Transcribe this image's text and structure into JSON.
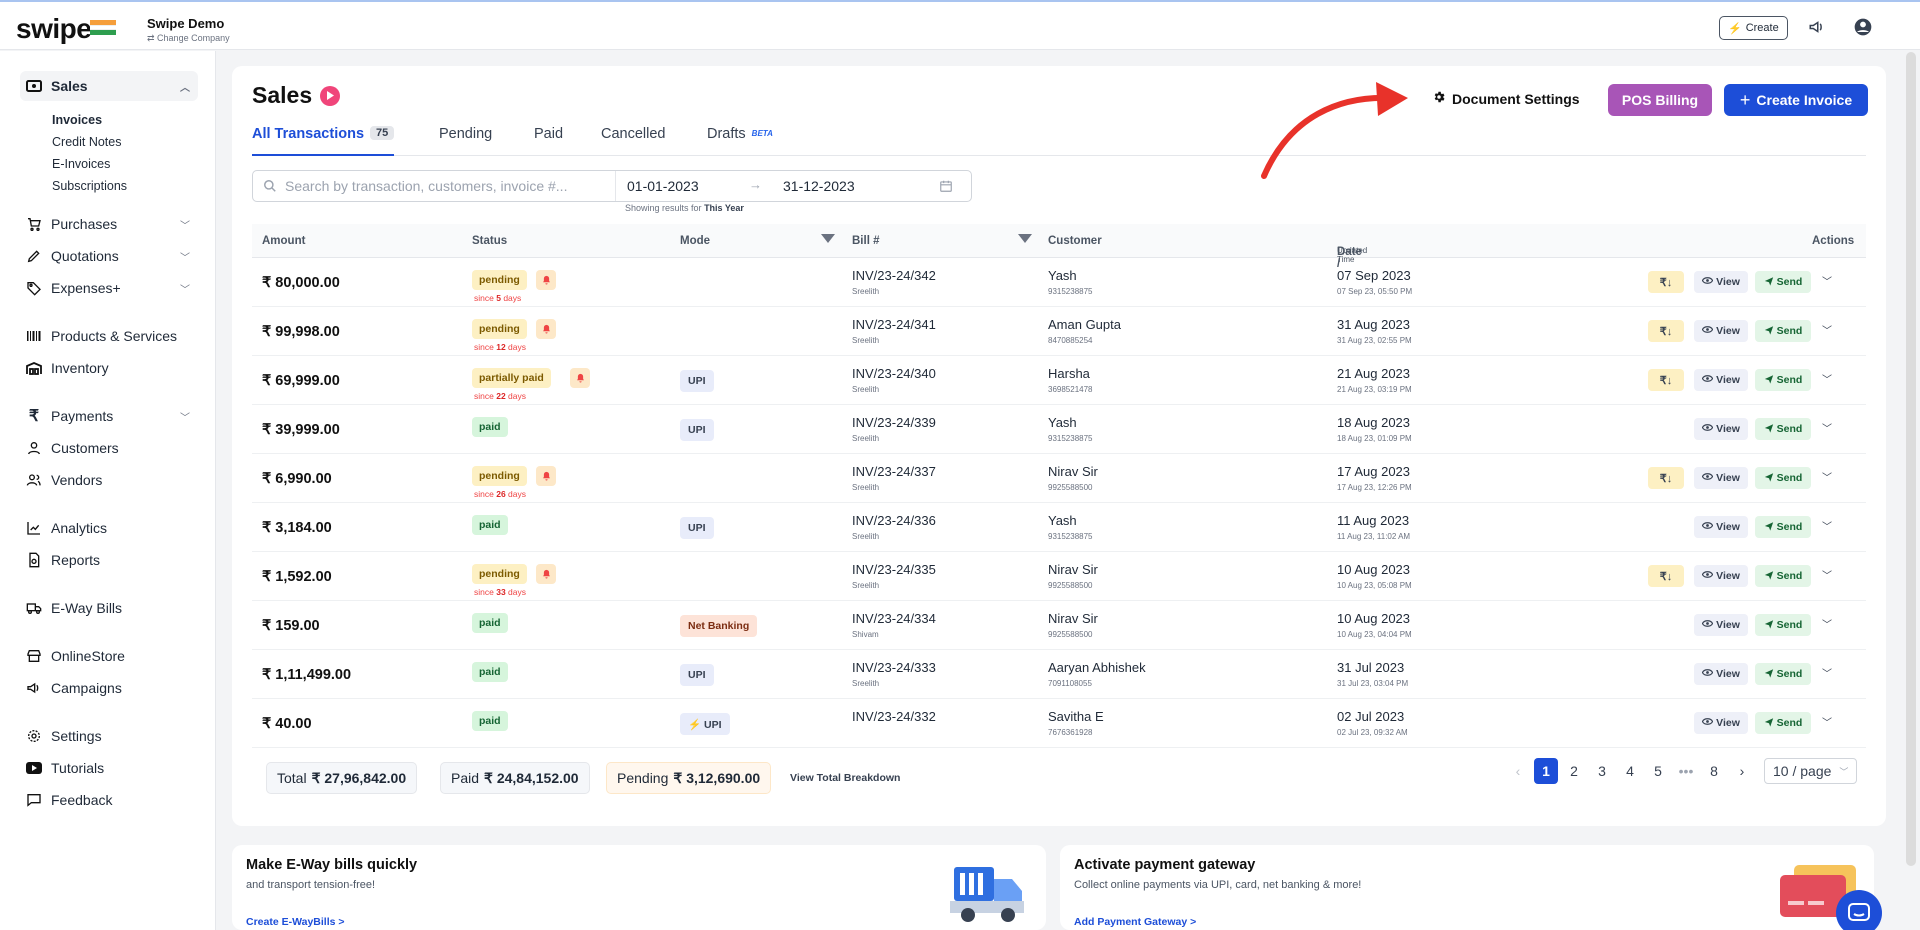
{
  "brand": {
    "logo": "swipe",
    "company": "Swipe Demo",
    "change_company": "Change Company"
  },
  "top": {
    "create": "Create"
  },
  "sidebar": {
    "sales": "Sales",
    "sales_sub": [
      "Invoices",
      "Credit Notes",
      "E-Invoices",
      "Subscriptions"
    ],
    "items": [
      "Purchases",
      "Quotations",
      "Expenses+",
      "Products & Services",
      "Inventory",
      "Payments",
      "Customers",
      "Vendors",
      "Analytics",
      "Reports",
      "E-Way Bills",
      "OnlineStore",
      "Campaigns",
      "Settings",
      "Tutorials",
      "Feedback"
    ]
  },
  "main": {
    "title": "Sales",
    "tabs": [
      {
        "label": "All Transactions",
        "count": "75"
      },
      {
        "label": "Pending"
      },
      {
        "label": "Paid"
      },
      {
        "label": "Cancelled"
      },
      {
        "label": "Drafts",
        "tag": "BETA"
      }
    ],
    "document_settings": "Document Settings",
    "pos_billing": "POS Billing",
    "create_invoice": "Create Invoice",
    "search_placeholder": "Search by transaction, customers, invoice #...",
    "date_from": "01-01-2023",
    "date_to": "31-12-2023",
    "showing_prefix": "Showing results for",
    "showing_range": "This Year",
    "columns": {
      "amount": "Amount",
      "status": "Status",
      "mode": "Mode",
      "bill": "Bill #",
      "customer": "Customer",
      "date": "Date /",
      "date_sub": "Updated Time",
      "actions": "Actions"
    }
  },
  "rows": [
    {
      "amount": "₹ 80,000.00",
      "status": "pending",
      "since_pre": "since ",
      "since_days": "5",
      "since_post": " days",
      "mode": "",
      "bill": "INV/23-24/342",
      "bill_sub": "Sreelith",
      "customer": "Yash",
      "phone": "9315238875",
      "date": "07 Sep 2023",
      "date_sub": "07 Sep 23, 05:50 PM",
      "rupee": true
    },
    {
      "amount": "₹ 99,998.00",
      "status": "pending",
      "since_pre": "since ",
      "since_days": "12",
      "since_post": " days",
      "mode": "",
      "bill": "INV/23-24/341",
      "bill_sub": "Sreelith",
      "customer": "Aman Gupta",
      "phone": "8470885254",
      "date": "31 Aug 2023",
      "date_sub": "31 Aug 23, 02:55 PM",
      "rupee": true
    },
    {
      "amount": "₹ 69,999.00",
      "status": "partially paid",
      "since_pre": "since ",
      "since_days": "22",
      "since_post": " days",
      "mode": "UPI",
      "bill": "INV/23-24/340",
      "bill_sub": "Sreelith",
      "customer": "Harsha",
      "phone": "3698521478",
      "date": "21 Aug 2023",
      "date_sub": "21 Aug 23, 03:19 PM",
      "rupee": true
    },
    {
      "amount": "₹ 39,999.00",
      "status": "paid",
      "since_pre": "",
      "since_days": "",
      "since_post": "",
      "mode": "UPI",
      "bill": "INV/23-24/339",
      "bill_sub": "Sreelith",
      "customer": "Yash",
      "phone": "9315238875",
      "date": "18 Aug 2023",
      "date_sub": "18 Aug 23, 01:09 PM",
      "rupee": false
    },
    {
      "amount": "₹ 6,990.00",
      "status": "pending",
      "since_pre": "since ",
      "since_days": "26",
      "since_post": " days",
      "mode": "",
      "bill": "INV/23-24/337",
      "bill_sub": "Sreelith",
      "customer": "Nirav Sir",
      "phone": "9925588500",
      "date": "17 Aug 2023",
      "date_sub": "17 Aug 23, 12:26 PM",
      "rupee": true
    },
    {
      "amount": "₹ 3,184.00",
      "status": "paid",
      "since_pre": "",
      "since_days": "",
      "since_post": "",
      "mode": "UPI",
      "bill": "INV/23-24/336",
      "bill_sub": "Sreelith",
      "customer": "Yash",
      "phone": "9315238875",
      "date": "11 Aug 2023",
      "date_sub": "11 Aug 23, 11:02 AM",
      "rupee": false
    },
    {
      "amount": "₹ 1,592.00",
      "status": "pending",
      "since_pre": "since ",
      "since_days": "33",
      "since_post": " days",
      "mode": "",
      "bill": "INV/23-24/335",
      "bill_sub": "Sreelith",
      "customer": "Nirav Sir",
      "phone": "9925588500",
      "date": "10 Aug 2023",
      "date_sub": "10 Aug 23, 05:08 PM",
      "rupee": true
    },
    {
      "amount": "₹ 159.00",
      "status": "paid",
      "since_pre": "",
      "since_days": "",
      "since_post": "",
      "mode": "Net Banking",
      "bill": "INV/23-24/334",
      "bill_sub": "Shivam",
      "customer": "Nirav Sir",
      "phone": "9925588500",
      "date": "10 Aug 2023",
      "date_sub": "10 Aug 23, 04:04 PM",
      "rupee": false
    },
    {
      "amount": "₹ 1,11,499.00",
      "status": "paid",
      "since_pre": "",
      "since_days": "",
      "since_post": "",
      "mode": "UPI",
      "bill": "INV/23-24/333",
      "bill_sub": "Sreelith",
      "customer": "Aaryan Abhishek",
      "phone": "7091108055",
      "date": "31 Jul 2023",
      "date_sub": "31 Jul 23, 03:04 PM",
      "rupee": false
    },
    {
      "amount": "₹ 40.00",
      "status": "paid",
      "since_pre": "",
      "since_days": "",
      "since_post": "",
      "mode": "⚡ UPI",
      "bill": "INV/23-24/332",
      "bill_sub": "",
      "customer": "Savitha E",
      "phone": "7676361928",
      "date": "02 Jul 2023",
      "date_sub": "02 Jul 23, 09:32 AM",
      "rupee": false
    }
  ],
  "actions": {
    "rupee": "₹↓",
    "view": "View",
    "send": "Send"
  },
  "totals": {
    "total_label": "Total",
    "total": "₹ 27,96,842.00",
    "paid_label": "Paid",
    "paid": "₹ 24,84,152.00",
    "pending_label": "Pending",
    "pending": "₹ 3,12,690.00",
    "breakdown": "View Total Breakdown"
  },
  "pagination": {
    "pages": [
      "1",
      "2",
      "3",
      "4",
      "5",
      "•••",
      "8"
    ],
    "per_page": "10 / page"
  },
  "promos": [
    {
      "title": "Make E-Way bills quickly",
      "sub": "and transport tension-free!",
      "link": "Create E-WayBills >"
    },
    {
      "title": "Activate payment gateway",
      "sub": "Collect online payments via UPI, card, net banking & more!",
      "link": "Add Payment Gateway >"
    }
  ],
  "colors": {
    "accent": "#1d4ed8",
    "pos": "#a855b7",
    "annotation_arrow": "#e8322a"
  }
}
